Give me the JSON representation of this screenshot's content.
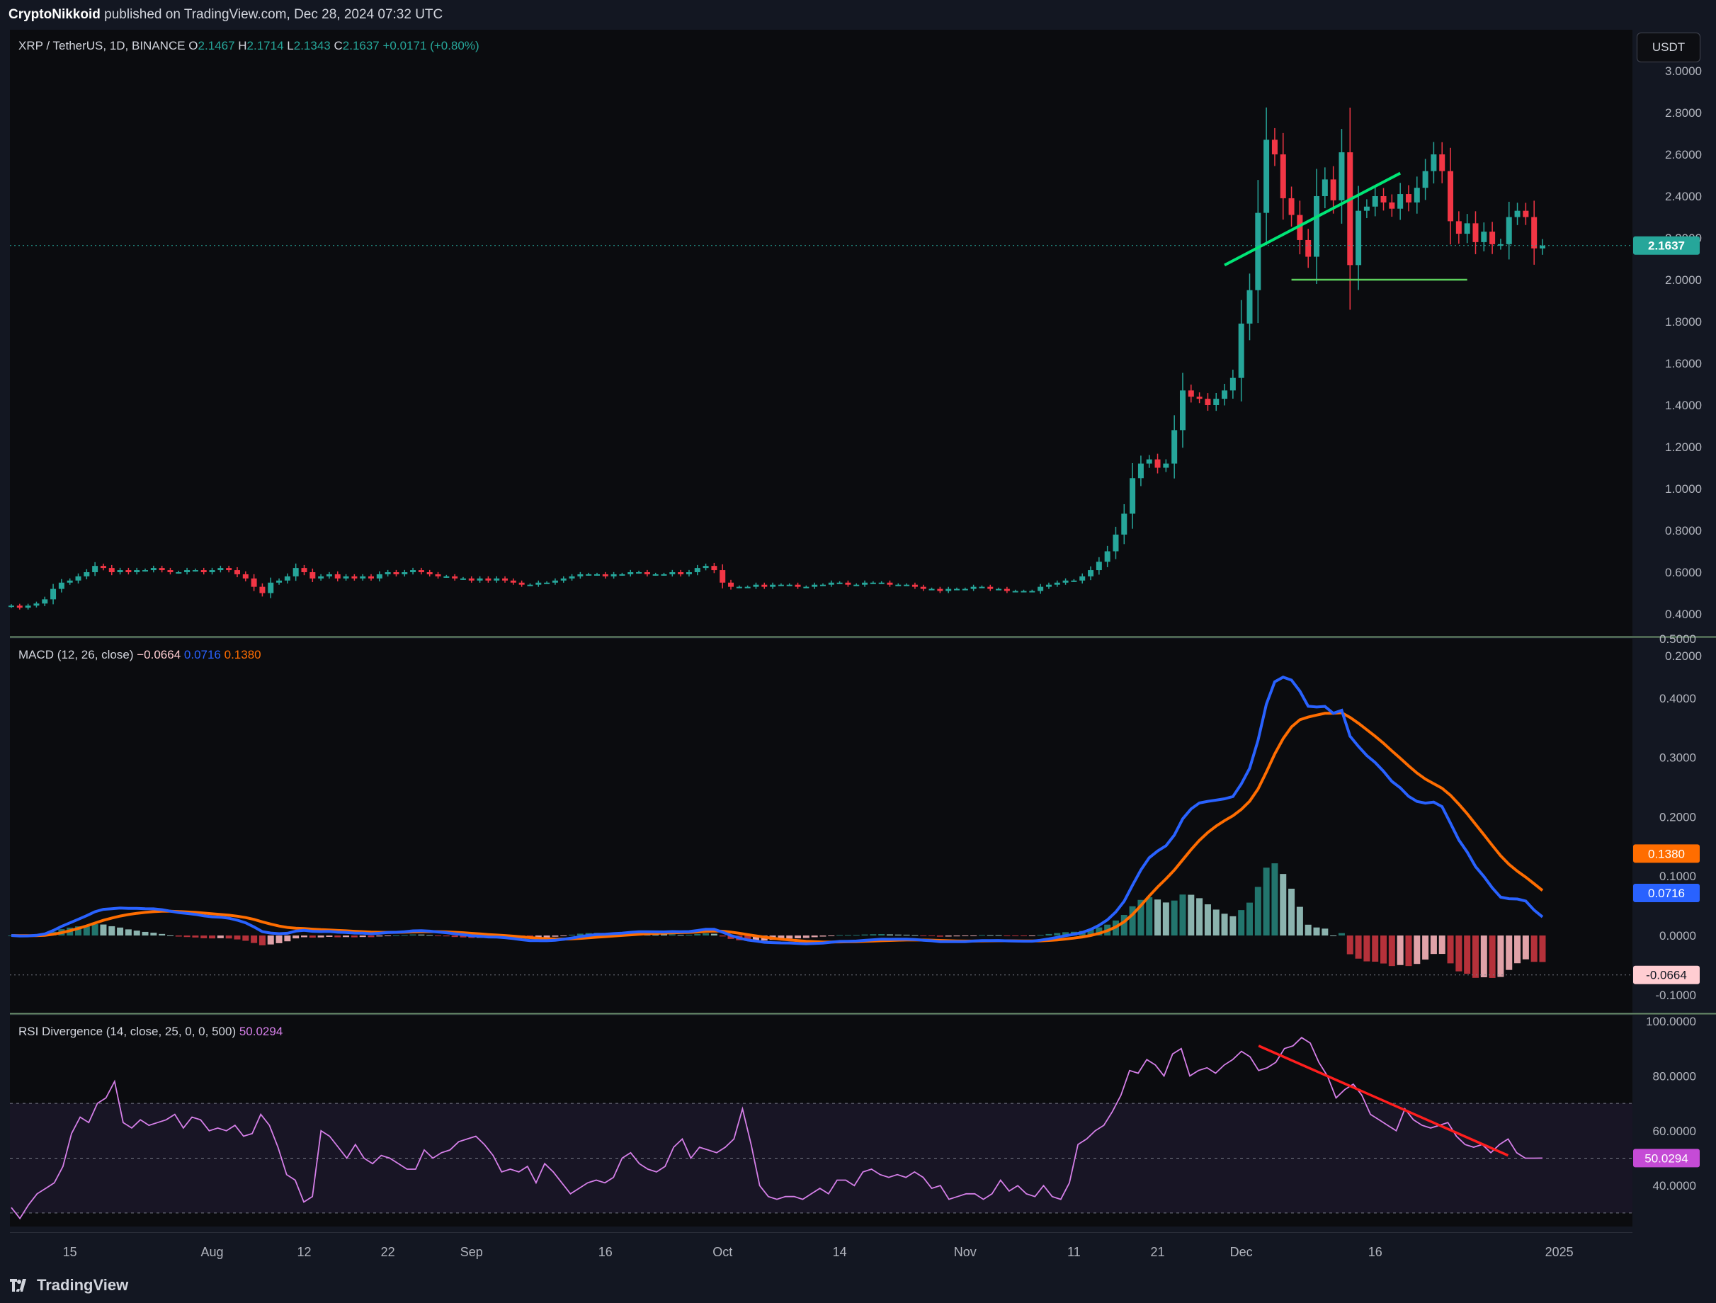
{
  "publish_line": {
    "author": "CryptoNikkoid",
    "text": "published on TradingView.com, Dec 28, 2024 07:32 UTC"
  },
  "currency_button": "USDT",
  "footer_brand": "TradingView",
  "colors": {
    "up": "#26a69a",
    "down": "#f23645",
    "macd": "#2962ff",
    "signal": "#ff6d00",
    "rsi": "#e040fb",
    "trend": "#00e676",
    "divergence": "#ff1e1e",
    "bg": "#0b0c0f"
  },
  "chart_data": [
    {
      "type": "candlestick",
      "title": "XRP / TetherUS, 1D, BINANCE",
      "legend": {
        "symbol": "XRP / TetherUS, 1D, BINANCE",
        "o_label": "O",
        "o": "2.1467",
        "h_label": "H",
        "h": "2.1714",
        "l_label": "L",
        "l": "2.1343",
        "c_label": "C",
        "c": "2.1637",
        "change": "+0.0171 (+0.80%)"
      },
      "last_price": "2.1637",
      "ylim": [
        0.2,
        3.0
      ],
      "y_ticks": [
        "3.0000",
        "2.8000",
        "2.6000",
        "2.4000",
        "2.2000",
        "2.0000",
        "1.8000",
        "1.6000",
        "1.4000",
        "1.2000",
        "1.0000",
        "0.8000",
        "0.6000",
        "0.4000",
        "0.2000"
      ],
      "x_ticks": [
        "15",
        "Aug",
        "12",
        "22",
        "Sep",
        "16",
        "Oct",
        "14",
        "Nov",
        "11",
        "21",
        "Dec",
        "16",
        "2025"
      ],
      "close_series_description": "daily closes Jul 8 - Dec 28 2024",
      "closes": [
        0.44,
        0.43,
        0.44,
        0.45,
        0.47,
        0.52,
        0.55,
        0.56,
        0.58,
        0.6,
        0.63,
        0.62,
        0.6,
        0.61,
        0.6,
        0.61,
        0.61,
        0.62,
        0.61,
        0.6,
        0.6,
        0.61,
        0.61,
        0.6,
        0.61,
        0.62,
        0.61,
        0.59,
        0.57,
        0.53,
        0.5,
        0.55,
        0.56,
        0.58,
        0.62,
        0.6,
        0.57,
        0.58,
        0.59,
        0.57,
        0.58,
        0.57,
        0.58,
        0.57,
        0.59,
        0.6,
        0.59,
        0.6,
        0.61,
        0.6,
        0.59,
        0.58,
        0.58,
        0.57,
        0.57,
        0.56,
        0.57,
        0.56,
        0.57,
        0.56,
        0.55,
        0.54,
        0.54,
        0.55,
        0.55,
        0.56,
        0.57,
        0.58,
        0.59,
        0.59,
        0.59,
        0.58,
        0.59,
        0.59,
        0.6,
        0.6,
        0.59,
        0.59,
        0.59,
        0.6,
        0.59,
        0.6,
        0.62,
        0.63,
        0.61,
        0.55,
        0.53,
        0.53,
        0.53,
        0.54,
        0.53,
        0.54,
        0.54,
        0.54,
        0.53,
        0.53,
        0.54,
        0.54,
        0.55,
        0.55,
        0.54,
        0.54,
        0.55,
        0.55,
        0.55,
        0.54,
        0.54,
        0.54,
        0.53,
        0.52,
        0.52,
        0.51,
        0.52,
        0.52,
        0.52,
        0.53,
        0.53,
        0.52,
        0.52,
        0.51,
        0.51,
        0.51,
        0.51,
        0.53,
        0.54,
        0.55,
        0.56,
        0.56,
        0.58,
        0.61,
        0.65,
        0.7,
        0.78,
        0.88,
        1.05,
        1.12,
        1.14,
        1.1,
        1.12,
        1.28,
        1.47,
        1.44,
        1.43,
        1.4,
        1.43,
        1.47,
        1.53,
        1.79,
        1.95,
        2.32,
        2.67,
        2.6,
        2.39,
        2.31,
        2.19,
        2.11,
        2.4,
        2.48,
        2.38,
        2.61,
        2.07,
        2.33,
        2.35,
        2.4,
        2.37,
        2.34,
        2.41,
        2.37,
        2.44,
        2.52,
        2.6,
        2.52,
        2.28,
        2.22,
        2.27,
        2.18,
        2.23,
        2.17,
        2.17,
        2.3,
        2.33,
        2.3,
        2.15,
        2.1637
      ],
      "annotations": {
        "ascending_trendline": "green line Nov 30 - Dec 20",
        "support_line": "2.0000 horizontal"
      }
    },
    {
      "type": "line",
      "title": "MACD (12, 26, close)",
      "legend": {
        "name": "MACD (12, 26, close)",
        "hist": "−0.0664",
        "macd": "0.0716",
        "signal": "0.1380"
      },
      "ylim": [
        -0.13,
        0.5
      ],
      "y_ticks": [
        "0.5000",
        "0.4000",
        "0.3000",
        "0.2000",
        "0.1000",
        "0.0000",
        "-0.1000"
      ],
      "labels": {
        "signal": "0.1380",
        "macd": "0.0716",
        "hist": "-0.0664"
      }
    },
    {
      "type": "line",
      "title": "RSI Divergence (14, close, 25, 0, 0, 500)",
      "legend": {
        "name": "RSI Divergence (14, close, 25, 0, 0, 500)",
        "value": "50.0294"
      },
      "ylim": [
        23,
        100
      ],
      "y_ticks": [
        "100.0000",
        "80.0000",
        "60.0000",
        "40.0000"
      ],
      "bands": {
        "upper": 70,
        "mid": 50,
        "lower": 30
      },
      "values": [
        32,
        28,
        33,
        37,
        39,
        41,
        47,
        59,
        65,
        63,
        70,
        72,
        78,
        63,
        61,
        64,
        62,
        63,
        64,
        66,
        61,
        65,
        64,
        60,
        61,
        60,
        62,
        58,
        59,
        66,
        62,
        54,
        44,
        42,
        34,
        36,
        60,
        58,
        54,
        50,
        55,
        50,
        48,
        51,
        50,
        48,
        46,
        46,
        53,
        50,
        52,
        53,
        56,
        57,
        58,
        55,
        51,
        45,
        46,
        45,
        47,
        41,
        48,
        45,
        41,
        37,
        39,
        41,
        42,
        41,
        43,
        50,
        52,
        48,
        46,
        45,
        47,
        54,
        57,
        50,
        54,
        53,
        52,
        54,
        57,
        68,
        55,
        40,
        36,
        35,
        36,
        36,
        35,
        37,
        39,
        37,
        42,
        42,
        40,
        45,
        46,
        44,
        43,
        44,
        43,
        45,
        43,
        39,
        40,
        35,
        36,
        37,
        37,
        35,
        37,
        42,
        38,
        40,
        37,
        36,
        40,
        36,
        35,
        41,
        55,
        57,
        60,
        62,
        67,
        73,
        82,
        81,
        86,
        84,
        80,
        88,
        90,
        80,
        82,
        83,
        81,
        84,
        86,
        89,
        87,
        82,
        83,
        85,
        90,
        91,
        94,
        92,
        85,
        80,
        72,
        75,
        77,
        73,
        66,
        64,
        62,
        60,
        68,
        64,
        62,
        61,
        62,
        63,
        58,
        55,
        54,
        55,
        52,
        55,
        57,
        52,
        50,
        50,
        50.03
      ],
      "annotations": {
        "divergence_line": "red line from RSI ~90 down to ~52"
      }
    }
  ]
}
